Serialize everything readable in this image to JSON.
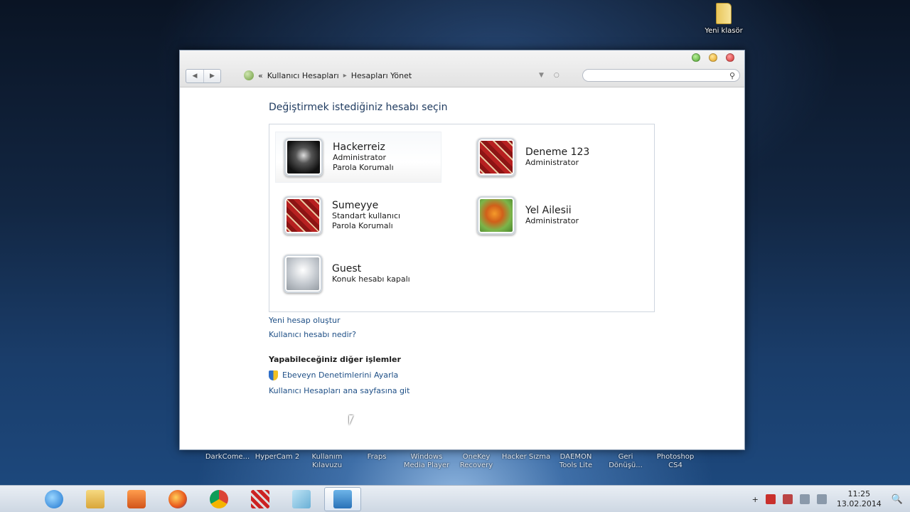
{
  "desktop": {
    "icon_label": "Yeni klasör",
    "shortcuts": [
      {
        "line1": "DarkCome...",
        "line2": ""
      },
      {
        "line1": "HyperCam 2",
        "line2": ""
      },
      {
        "line1": "Kullanım",
        "line2": "Kılavuzu"
      },
      {
        "line1": "Fraps",
        "line2": ""
      },
      {
        "line1": "Windows",
        "line2": "Media Player"
      },
      {
        "line1": "OneKey",
        "line2": "Recovery"
      },
      {
        "line1": "Hacker Sızma",
        "line2": ""
      },
      {
        "line1": "DAEMON",
        "line2": "Tools Lite"
      },
      {
        "line1": "Geri",
        "line2": "Dönüşü..."
      },
      {
        "line1": "Photoshop",
        "line2": "CS4"
      }
    ]
  },
  "window": {
    "breadcrumb": {
      "prefix": "«",
      "item1": "Kullanıcı Hesapları",
      "item2": "Hesapları Yönet"
    },
    "search_placeholder": ""
  },
  "main": {
    "heading": "Değiştirmek istediğiniz hesabı seçin",
    "accounts": [
      {
        "name": "Hackerreiz",
        "line1": "Administrator",
        "line2": "Parola Korumalı",
        "avatar": "skull"
      },
      {
        "name": "Deneme 123",
        "line1": "Administrator",
        "line2": "",
        "avatar": "red-pattern"
      },
      {
        "name": "Sumeyye",
        "line1": "Standart kullanıcı",
        "line2": "Parola Korumalı",
        "avatar": "red-pattern"
      },
      {
        "name": "Yel Ailesii",
        "line1": "Administrator",
        "line2": "",
        "avatar": "butterfly"
      },
      {
        "name": "Guest",
        "line1": "Konuk hesabı kapalı",
        "line2": "",
        "avatar": "guest"
      }
    ],
    "links": {
      "create_account": "Yeni hesap oluştur",
      "what_is_account": "Kullanıcı hesabı nedir?"
    },
    "other_tasks": {
      "title": "Yapabileceğiniz diğer işlemler",
      "parental_controls": "Ebeveyn Denetimlerini Ayarla",
      "go_home": "Kullanıcı Hesapları ana sayfasına git"
    }
  },
  "taskbar": {
    "start_glyph": "",
    "tray_plus": "+",
    "clock_time": "11:25",
    "clock_date": "13.02.2014",
    "search_glyph": "🔍"
  }
}
